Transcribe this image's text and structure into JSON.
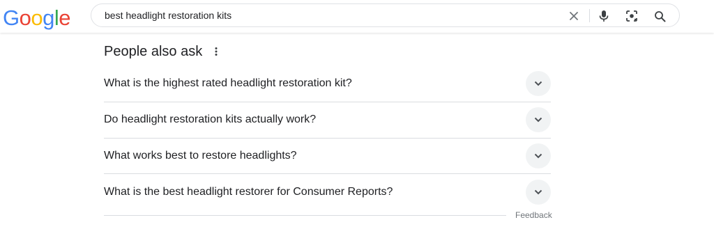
{
  "logo": {
    "letters": [
      {
        "char": "G",
        "color": "#4285F4"
      },
      {
        "char": "o",
        "color": "#EA4335"
      },
      {
        "char": "o",
        "color": "#FBBC05"
      },
      {
        "char": "g",
        "color": "#4285F4"
      },
      {
        "char": "l",
        "color": "#34A853"
      },
      {
        "char": "e",
        "color": "#EA4335"
      }
    ]
  },
  "search": {
    "value": "best headlight restoration kits",
    "icons": [
      "close-icon",
      "microphone-icon",
      "lens-icon",
      "search-icon"
    ]
  },
  "paa": {
    "title": "People also ask",
    "questions": [
      {
        "text": "What is the highest rated headlight restoration kit?"
      },
      {
        "text": "Do headlight restoration kits actually work?"
      },
      {
        "text": "What works best to restore headlights?"
      },
      {
        "text": "What is the best headlight restorer for Consumer Reports?"
      }
    ],
    "feedback": "Feedback"
  },
  "colors": {
    "text": "#202124",
    "divider": "#dadce0",
    "chevron_bg": "#f1f3f4",
    "muted": "#70757a"
  }
}
